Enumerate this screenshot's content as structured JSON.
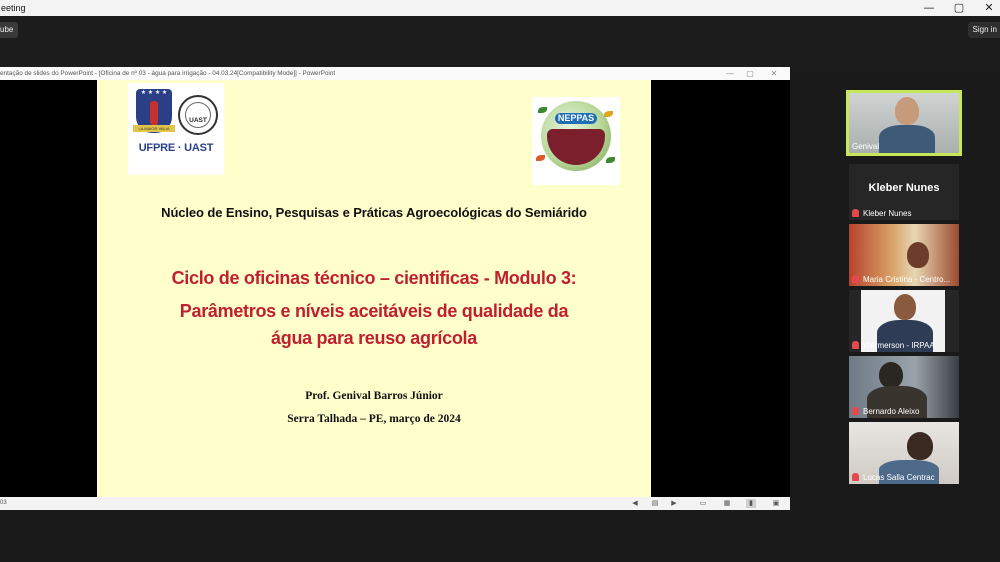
{
  "window": {
    "title": "eeting",
    "controls": [
      "—",
      "▢",
      "✕"
    ]
  },
  "topbar": {
    "left_chip": "ube",
    "right_chip": "Sign in"
  },
  "ppt": {
    "title": "entação de slides do PowerPoint - [Oficina de nº 03 - água para irrigação - 04.03.24[Compatibility Mode]] - PowerPoint",
    "controls": [
      "—",
      "▢",
      "✕"
    ],
    "status_number": "03"
  },
  "slide": {
    "logo_left": {
      "brand": "UFPRE · UAST",
      "seal": "UAST",
      "ribbon": "LA MAIOR VALIA"
    },
    "logo_right": {
      "name": "NEPPAS"
    },
    "institution": "Núcleo de Ensino, Pesquisas e Práticas Agroecológicas do Semiárido",
    "module": "Ciclo de oficinas técnico – cientificas - Modulo 3:",
    "params_line1": "Parâmetros e níveis aceitáveis de qualidade da",
    "params_line2": "água para reuso agrícola",
    "professor": "Prof. Genival Barros Júnior",
    "place_date": "Serra Talhada – PE, março de 2024"
  },
  "participants": [
    {
      "name": "Genival",
      "speaking": true,
      "muted": false
    },
    {
      "name": "Kleber Nunes",
      "big_name": "Kleber Nunes",
      "muted": true
    },
    {
      "name": "Maria Cristina - Centro...",
      "muted": true
    },
    {
      "name": "Wermerson - IRPAA",
      "muted": true
    },
    {
      "name": "Bernardo Aleixo",
      "muted": true
    },
    {
      "name": "Lucas Salla Centrac",
      "muted": true
    }
  ],
  "icons": {
    "status": [
      "prev-slide-icon",
      "notes-icon",
      "next-slide-icon",
      "normal-view-icon",
      "slide-sorter-icon",
      "reading-view-icon",
      "slideshow-icon",
      "fit-icon"
    ]
  },
  "colors": {
    "slide_bg": "#ffffcc",
    "title_red": "#c01f2f",
    "speaker_border": "#c8e65a",
    "mute_red": "#e5484d"
  }
}
